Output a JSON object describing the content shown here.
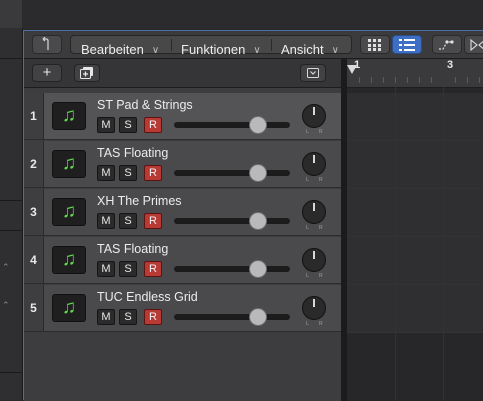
{
  "toolbar": {
    "back_icon": "back-arrow-icon",
    "menus": [
      {
        "label": "Bearbeiten"
      },
      {
        "label": "Funktionen"
      },
      {
        "label": "Ansicht"
      }
    ],
    "view_grid_icon": "grid-view-icon",
    "view_list_icon": "list-view-icon",
    "automation_icon": "automation-curve-icon",
    "flex_icon": "flex-time-icon"
  },
  "subbar": {
    "add_track_label": "+",
    "duplicate_icon": "duplicate-track-icon",
    "collapse_icon": "chevron-down-icon"
  },
  "tracks": [
    {
      "number": "1",
      "name": "ST Pad & Strings",
      "mute": "M",
      "solo": "S",
      "record": "R",
      "selected": true
    },
    {
      "number": "2",
      "name": "TAS Floating",
      "mute": "M",
      "solo": "S",
      "record": "R",
      "selected": false
    },
    {
      "number": "3",
      "name": "XH The Primes",
      "mute": "M",
      "solo": "S",
      "record": "R",
      "selected": false
    },
    {
      "number": "4",
      "name": "TAS Floating",
      "mute": "M",
      "solo": "S",
      "record": "R",
      "selected": false
    },
    {
      "number": "5",
      "name": "TUC Endless Grid",
      "mute": "M",
      "solo": "S",
      "record": "R",
      "selected": false
    }
  ],
  "pan_labels": {
    "left": "L",
    "right": "R"
  },
  "ruler": {
    "bars": [
      "1",
      "3"
    ]
  },
  "colors": {
    "accent": "#4a6fa5",
    "record": "#b83a34",
    "instrument_icon": "#62d94e"
  }
}
